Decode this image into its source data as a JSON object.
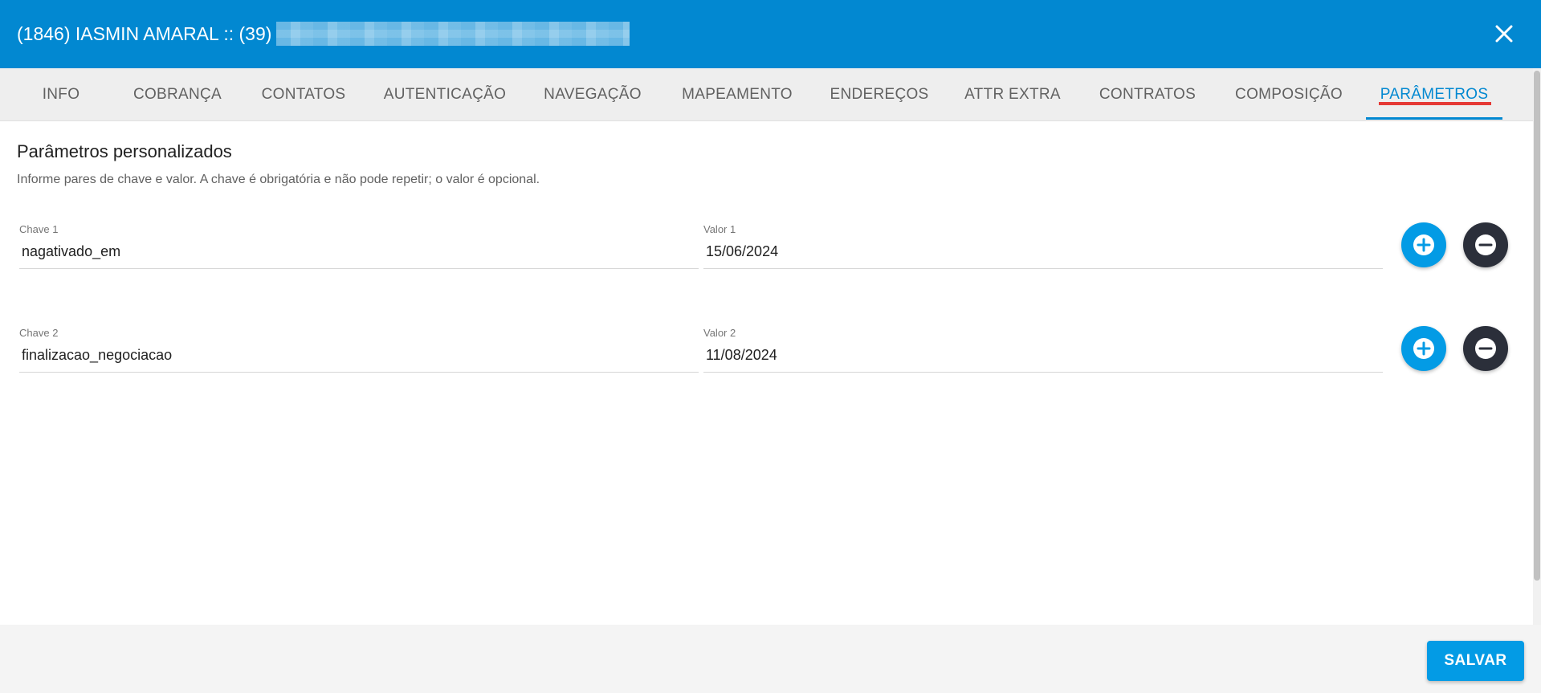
{
  "header": {
    "title": "(1846) IASMIN AMARAL :: (39)",
    "close_icon": "close-icon"
  },
  "tabs": [
    {
      "label": "INFO",
      "active": false
    },
    {
      "label": "COBRANÇA",
      "active": false
    },
    {
      "label": "CONTATOS",
      "active": false
    },
    {
      "label": "AUTENTICAÇÃO",
      "active": false
    },
    {
      "label": "NAVEGAÇÃO",
      "active": false
    },
    {
      "label": "MAPEAMENTO",
      "active": false
    },
    {
      "label": "ENDEREÇOS",
      "active": false
    },
    {
      "label": "ATTR EXTRA",
      "active": false
    },
    {
      "label": "CONTRATOS",
      "active": false
    },
    {
      "label": "COMPOSIÇÃO",
      "active": false
    },
    {
      "label": "PARÂMETROS",
      "active": true
    }
  ],
  "section": {
    "title": "Parâmetros personalizados",
    "subtitle": "Informe pares de chave e valor. A chave é obrigatória e não pode repetir; o valor é opcional."
  },
  "params": [
    {
      "key_label": "Chave 1",
      "key_value": "nagativado_em",
      "value_label": "Valor 1",
      "value_value": "15/06/2024"
    },
    {
      "key_label": "Chave 2",
      "key_value": "finalizacao_negociacao",
      "value_label": "Valor 2",
      "value_value": "11/08/2024"
    }
  ],
  "icons": {
    "add": "plus-circle-icon",
    "remove": "minus-circle-icon"
  },
  "footer": {
    "save_label": "SALVAR"
  },
  "colors": {
    "primary": "#0288d1",
    "accent": "#039be5",
    "dark": "#2b2f3a",
    "highlight": "#e53935"
  }
}
